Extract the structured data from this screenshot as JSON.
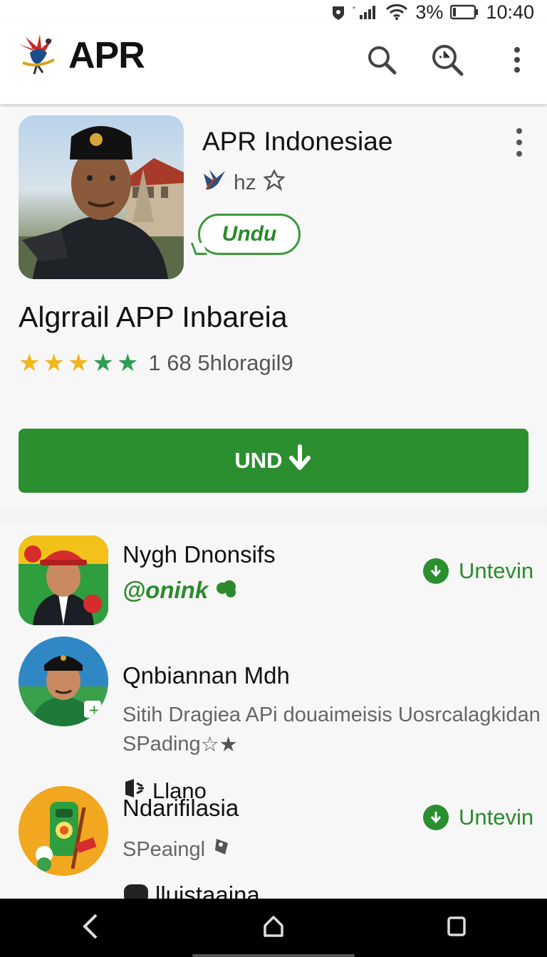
{
  "status_bar": {
    "battery": "3%",
    "time": "10:40"
  },
  "app_bar": {
    "title": "APR"
  },
  "app": {
    "name": "APR Indonesiae",
    "developer": "hz",
    "pill_label": "Undu",
    "headline": "Algrrail APP Inbareia",
    "rating": {
      "value": 4.5,
      "text": "1 68  5hloragil9"
    },
    "install_label": "UND"
  },
  "list": [
    {
      "title": "Nygh Dnonsifs",
      "subtitle": "@onink",
      "action": "Untevin"
    },
    {
      "title": "Qnbiannan Mdh",
      "subtitle": "Sitih Dragiea APi douaimeisis Uosrcalagkidan",
      "subtitle2": "SPading",
      "tag": "Llano"
    },
    {
      "title": "Ndarifilasia",
      "subtitle": "SPeaingl",
      "action": "Untevin"
    },
    {
      "title": "lluistaaina"
    }
  ],
  "colors": {
    "accent": "#2b8f2f",
    "star_yellow": "#f2b51a",
    "star_green": "#2f9e55"
  },
  "icons": [
    "search-icon",
    "zoom-clock-icon",
    "more-vert-icon",
    "back-icon",
    "home-icon",
    "recents-icon"
  ]
}
